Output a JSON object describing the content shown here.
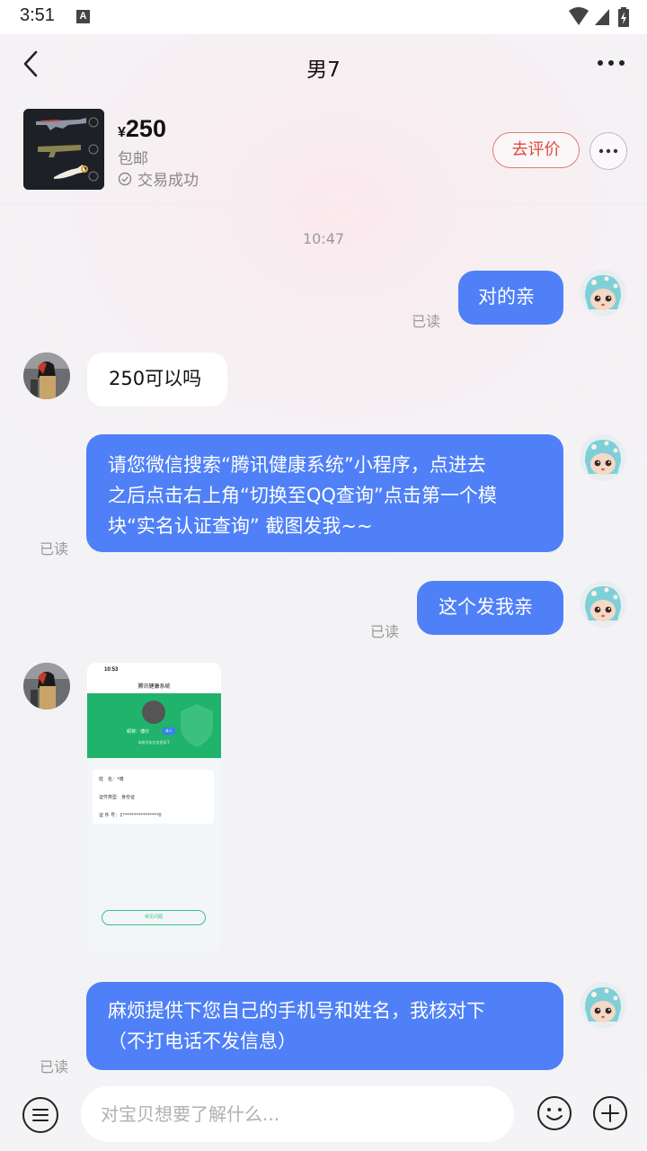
{
  "status_bar": {
    "time": "3:51",
    "a_icon_label": "A"
  },
  "nav": {
    "title": "男7"
  },
  "product": {
    "currency": "¥",
    "price": "250",
    "shipping": "包邮",
    "deal_status": "交易成功",
    "review_button": "去评价"
  },
  "chat": {
    "timestamp": "10:47",
    "messages": [
      {
        "side": "me",
        "text": "对的亲",
        "read": "已读"
      },
      {
        "side": "them",
        "text": "250可以吗"
      },
      {
        "side": "me",
        "lines": [
          "请您微信搜索“腾讯健康系统”小程序，点进去",
          "之后点击右上角“切换至QQ查询”点击第一个模",
          "块“实名认证查询” 截图发我~~"
        ],
        "read": "已读"
      },
      {
        "side": "me",
        "text": "这个发我亲",
        "read": "已读"
      },
      {
        "side": "them",
        "type": "image"
      },
      {
        "side": "me",
        "lines": [
          "麻烦提供下您自己的手机号和姓名，我核对下",
          "（不打电话不发信息）"
        ],
        "read": "已读"
      }
    ]
  },
  "shared_image": {
    "time": "10:53",
    "title": "腾讯健康系统",
    "greeting": "昵称：博仔",
    "badge": "本人",
    "note": "本账号实名信息如下",
    "name_label": "姓　名：",
    "name_value": "*博",
    "id_type_label": "证件类型",
    "id_type_value": "身份证",
    "id_no_label": "证 件 号：",
    "id_no_value": "1****************0",
    "faq_button": "常见问题"
  },
  "input": {
    "placeholder": "对宝贝想要了解什么..."
  },
  "colors": {
    "bubble_me": "#4f80f7",
    "bubble_them": "#ffffff",
    "review_red": "#e0483e"
  }
}
